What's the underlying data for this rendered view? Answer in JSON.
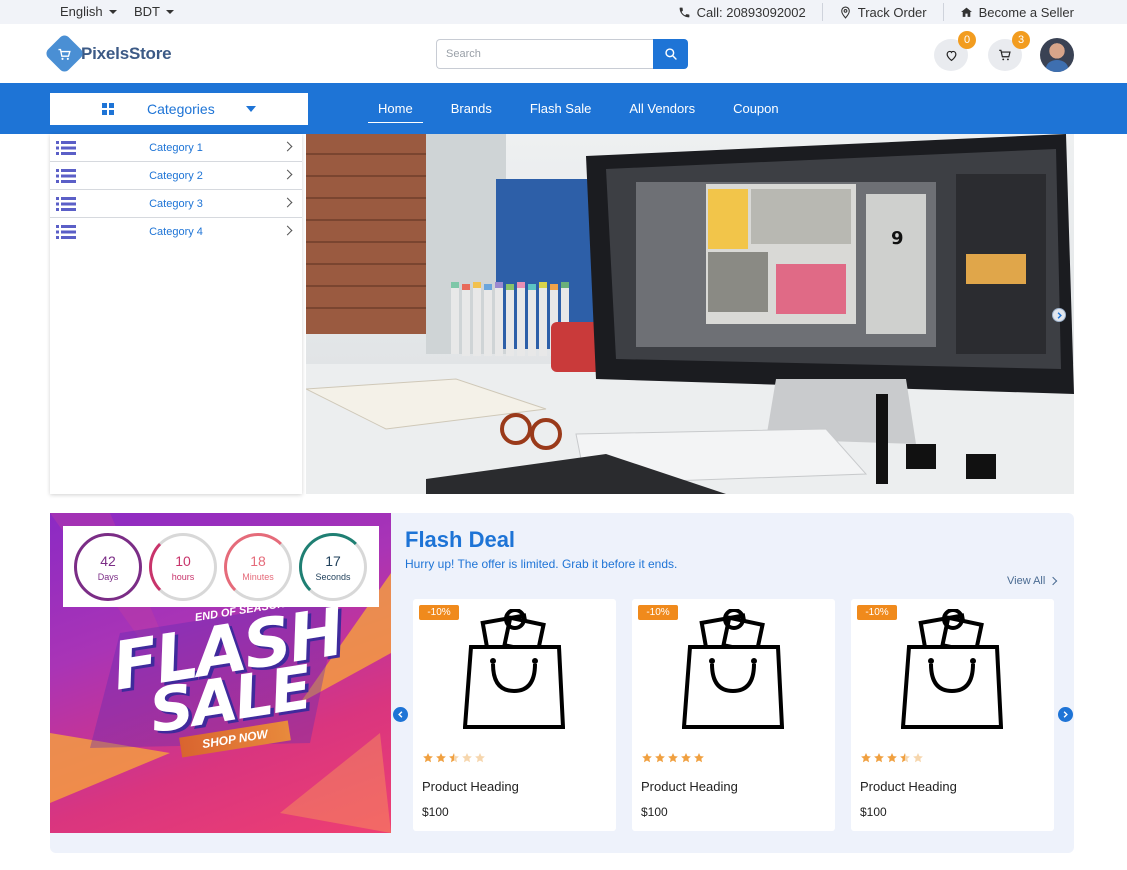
{
  "topbar": {
    "language": "English",
    "currency": "BDT",
    "call": "Call: 20893092002",
    "track_order": "Track Order",
    "become_seller": "Become a Seller"
  },
  "header": {
    "brand": "PixelsStore",
    "search_placeholder": "Search",
    "wishlist_count": "0",
    "cart_count": "3"
  },
  "nav": {
    "categories_label": "Categories",
    "items": [
      {
        "label": "Home",
        "active": true
      },
      {
        "label": "Brands"
      },
      {
        "label": "Flash Sale"
      },
      {
        "label": "All Vendors"
      },
      {
        "label": "Coupon"
      }
    ]
  },
  "sidebar": {
    "categories": [
      "Category 1",
      "Category 2",
      "Category 3",
      "Category 4"
    ]
  },
  "countdown": [
    {
      "value": "42",
      "unit": "Days",
      "color": "#7b2d86"
    },
    {
      "value": "10",
      "unit": "hours",
      "color": "#c8346b"
    },
    {
      "value": "18",
      "unit": "Minutes",
      "color": "#e56b7a"
    },
    {
      "value": "17",
      "unit": "Seconds",
      "color": "#1f7f73"
    }
  ],
  "promo": {
    "line1": "END OF SEASON",
    "line2": "FLASH",
    "line3": "SALE",
    "cta": "SHOP NOW"
  },
  "flash_deal": {
    "title": "Flash Deal",
    "subtitle": "Hurry up! The offer is limited. Grab it before it ends.",
    "view_all": "View All",
    "products": [
      {
        "discount": "-10%",
        "name": "Product Heading",
        "price": "$100",
        "rating": 2.5
      },
      {
        "discount": "-10%",
        "name": "Product Heading",
        "price": "$100",
        "rating": 5
      },
      {
        "discount": "-10%",
        "name": "Product Heading",
        "price": "$100",
        "rating": 3.5
      }
    ]
  },
  "colors": {
    "primary": "#1e74d6",
    "badge": "#f29c1f",
    "discount": "#f08a1c",
    "star": "#f0a040"
  }
}
